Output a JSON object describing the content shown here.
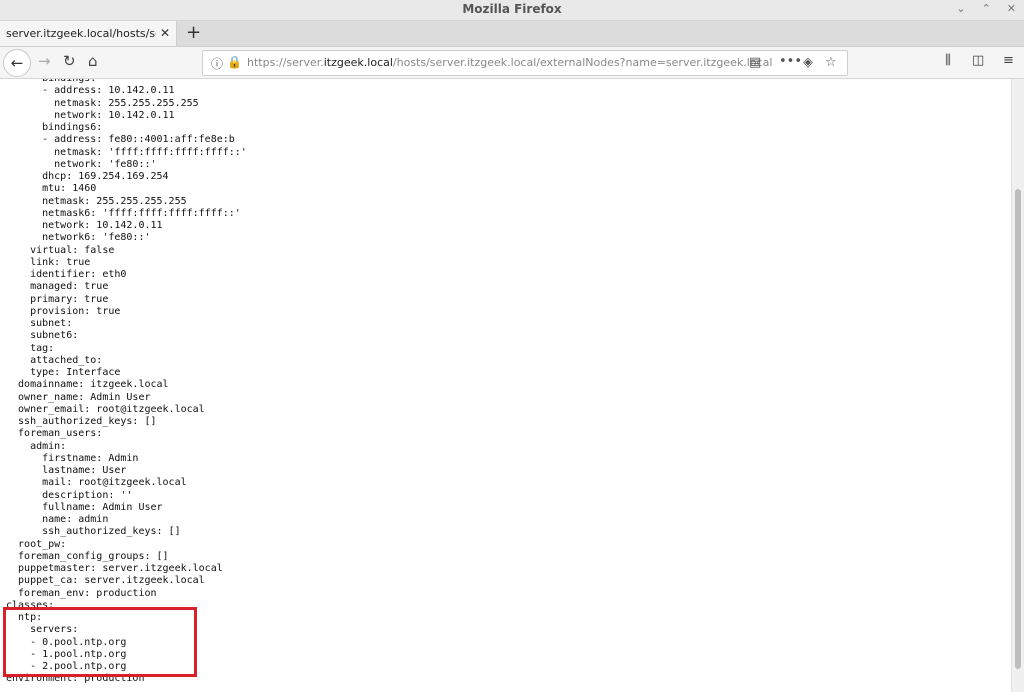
{
  "window": {
    "title": "Mozilla Firefox",
    "controls": [
      "⌄",
      "⌃",
      "✕"
    ]
  },
  "tabs": [
    {
      "title": "server.itzgeek.local/hosts/server.itzgeek.local/externalNodes?name=server.itzgeek.local",
      "active": true
    }
  ],
  "navbar": {
    "back_icon": "←",
    "forward_icon": "→",
    "reload_icon": "↻",
    "home_icon": "⌂",
    "url_prefix": "https://server.",
    "url_host": "itzgeek.local",
    "url_suffix": "/hosts/server.itzgeek.local/externalNodes?name=server.itzgeek.local",
    "reader_icon": "▤",
    "more_icon": "•••",
    "pocket_icon": "◈",
    "bookmark_icon": "☆",
    "library_icon": "⫼",
    "sidebar_icon": "◫",
    "menu_icon": "≡"
  },
  "yaml_lines": [
    "      bindings:",
    "      - address: 10.142.0.11",
    "        netmask: 255.255.255.255",
    "        network: 10.142.0.11",
    "      bindings6:",
    "      - address: fe80::4001:aff:fe8e:b",
    "        netmask: 'ffff:ffff:ffff:ffff::'",
    "        network: 'fe80::'",
    "      dhcp: 169.254.169.254",
    "      mtu: 1460",
    "      netmask: 255.255.255.255",
    "      netmask6: 'ffff:ffff:ffff:ffff::'",
    "      network: 10.142.0.11",
    "      network6: 'fe80::'",
    "    virtual: false",
    "    link: true",
    "    identifier: eth0",
    "    managed: true",
    "    primary: true",
    "    provision: true",
    "    subnet:",
    "    subnet6:",
    "    tag:",
    "    attached_to:",
    "    type: Interface",
    "  domainname: itzgeek.local",
    "  owner_name: Admin User",
    "  owner_email: root@itzgeek.local",
    "  ssh_authorized_keys: []",
    "  foreman_users:",
    "    admin:",
    "      firstname: Admin",
    "      lastname: User",
    "      mail: root@itzgeek.local",
    "      description: ''",
    "      fullname: Admin User",
    "      name: admin",
    "      ssh_authorized_keys: []",
    "  root_pw:",
    "  foreman_config_groups: []",
    "  puppetmaster: server.itzgeek.local",
    "  puppet_ca: server.itzgeek.local",
    "  foreman_env: production",
    "classes:",
    "  ntp:",
    "    servers:",
    "    - 0.pool.ntp.org",
    "    - 1.pool.ntp.org",
    "    - 2.pool.ntp.org",
    "environment: production"
  ],
  "annotation": {
    "color": "#d9202a"
  }
}
